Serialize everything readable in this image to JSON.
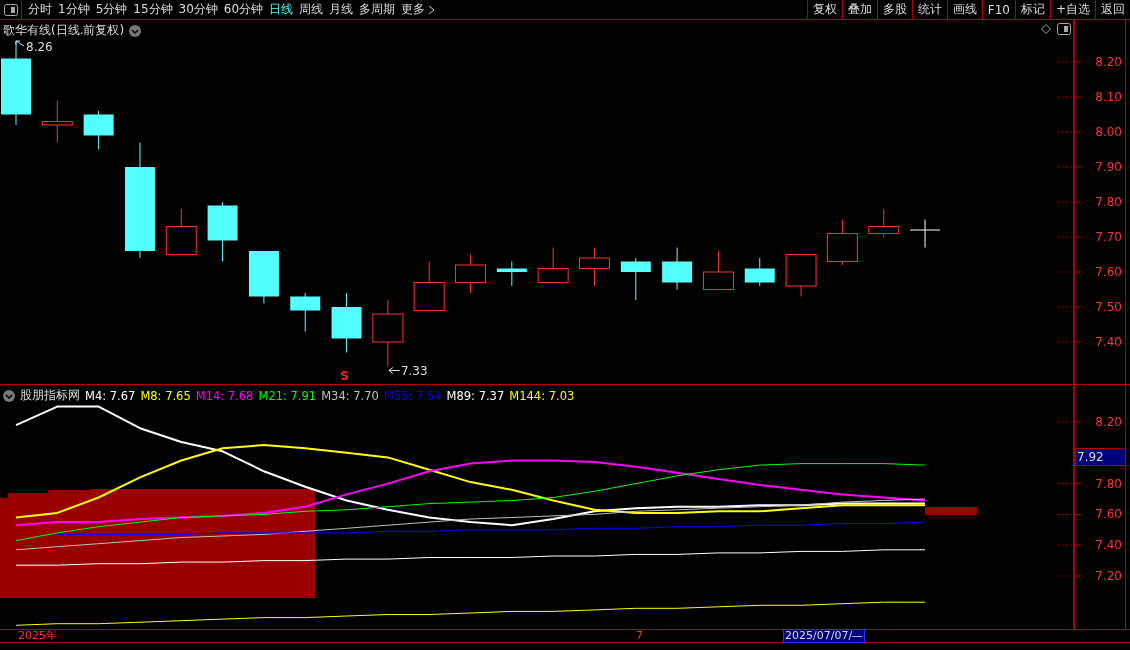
{
  "toolbar": {
    "tabs": [
      {
        "label": "分时",
        "selected": false
      },
      {
        "label": "1分钟",
        "selected": false
      },
      {
        "label": "5分钟",
        "selected": false
      },
      {
        "label": "15分钟",
        "selected": false
      },
      {
        "label": "30分钟",
        "selected": false
      },
      {
        "label": "60分钟",
        "selected": false
      },
      {
        "label": "日线",
        "selected": true
      },
      {
        "label": "周线",
        "selected": false
      },
      {
        "label": "月线",
        "selected": false
      },
      {
        "label": "多周期",
        "selected": false
      },
      {
        "label": "更多",
        "selected": false
      }
    ],
    "buttons": [
      "复权",
      "叠加",
      "多股",
      "统计",
      "画线",
      "F10",
      "标记",
      "+自选",
      "返回"
    ]
  },
  "main_pane": {
    "title": "歌华有线(日线.前复权)",
    "high_label": "8.26",
    "low_label": "7.33",
    "signal_mark": "S",
    "axis_labels": [
      "8.20",
      "8.10",
      "8.00",
      "7.90",
      "7.80",
      "7.70",
      "7.60",
      "7.50",
      "7.40"
    ]
  },
  "indicator_pane": {
    "title": "股朋指标网",
    "legend": [
      {
        "text": "M4: 7.67",
        "color": "#ffffff"
      },
      {
        "text": "M8: 7.65",
        "color": "#ffff00"
      },
      {
        "text": "M14: 7.68",
        "color": "#ff00ff"
      },
      {
        "text": "M21: 7.91",
        "color": "#00ff00"
      },
      {
        "text": "M34: 7.70",
        "color": "#c0c0c0"
      },
      {
        "text": "M55: 7.54",
        "color": "#0000ff"
      },
      {
        "text": "M89: 7.37",
        "color": "#ffffff"
      },
      {
        "text": "M144: 7.03",
        "color": "#ffff00"
      }
    ],
    "axis_labels": [
      "8.20",
      "7.80",
      "7.60",
      "7.40",
      "7.20"
    ],
    "cursor_value": "7.92"
  },
  "time_axis": {
    "labels": [
      "2025年",
      "7"
    ],
    "cursor_date": "2025/07/07/—"
  }
}
